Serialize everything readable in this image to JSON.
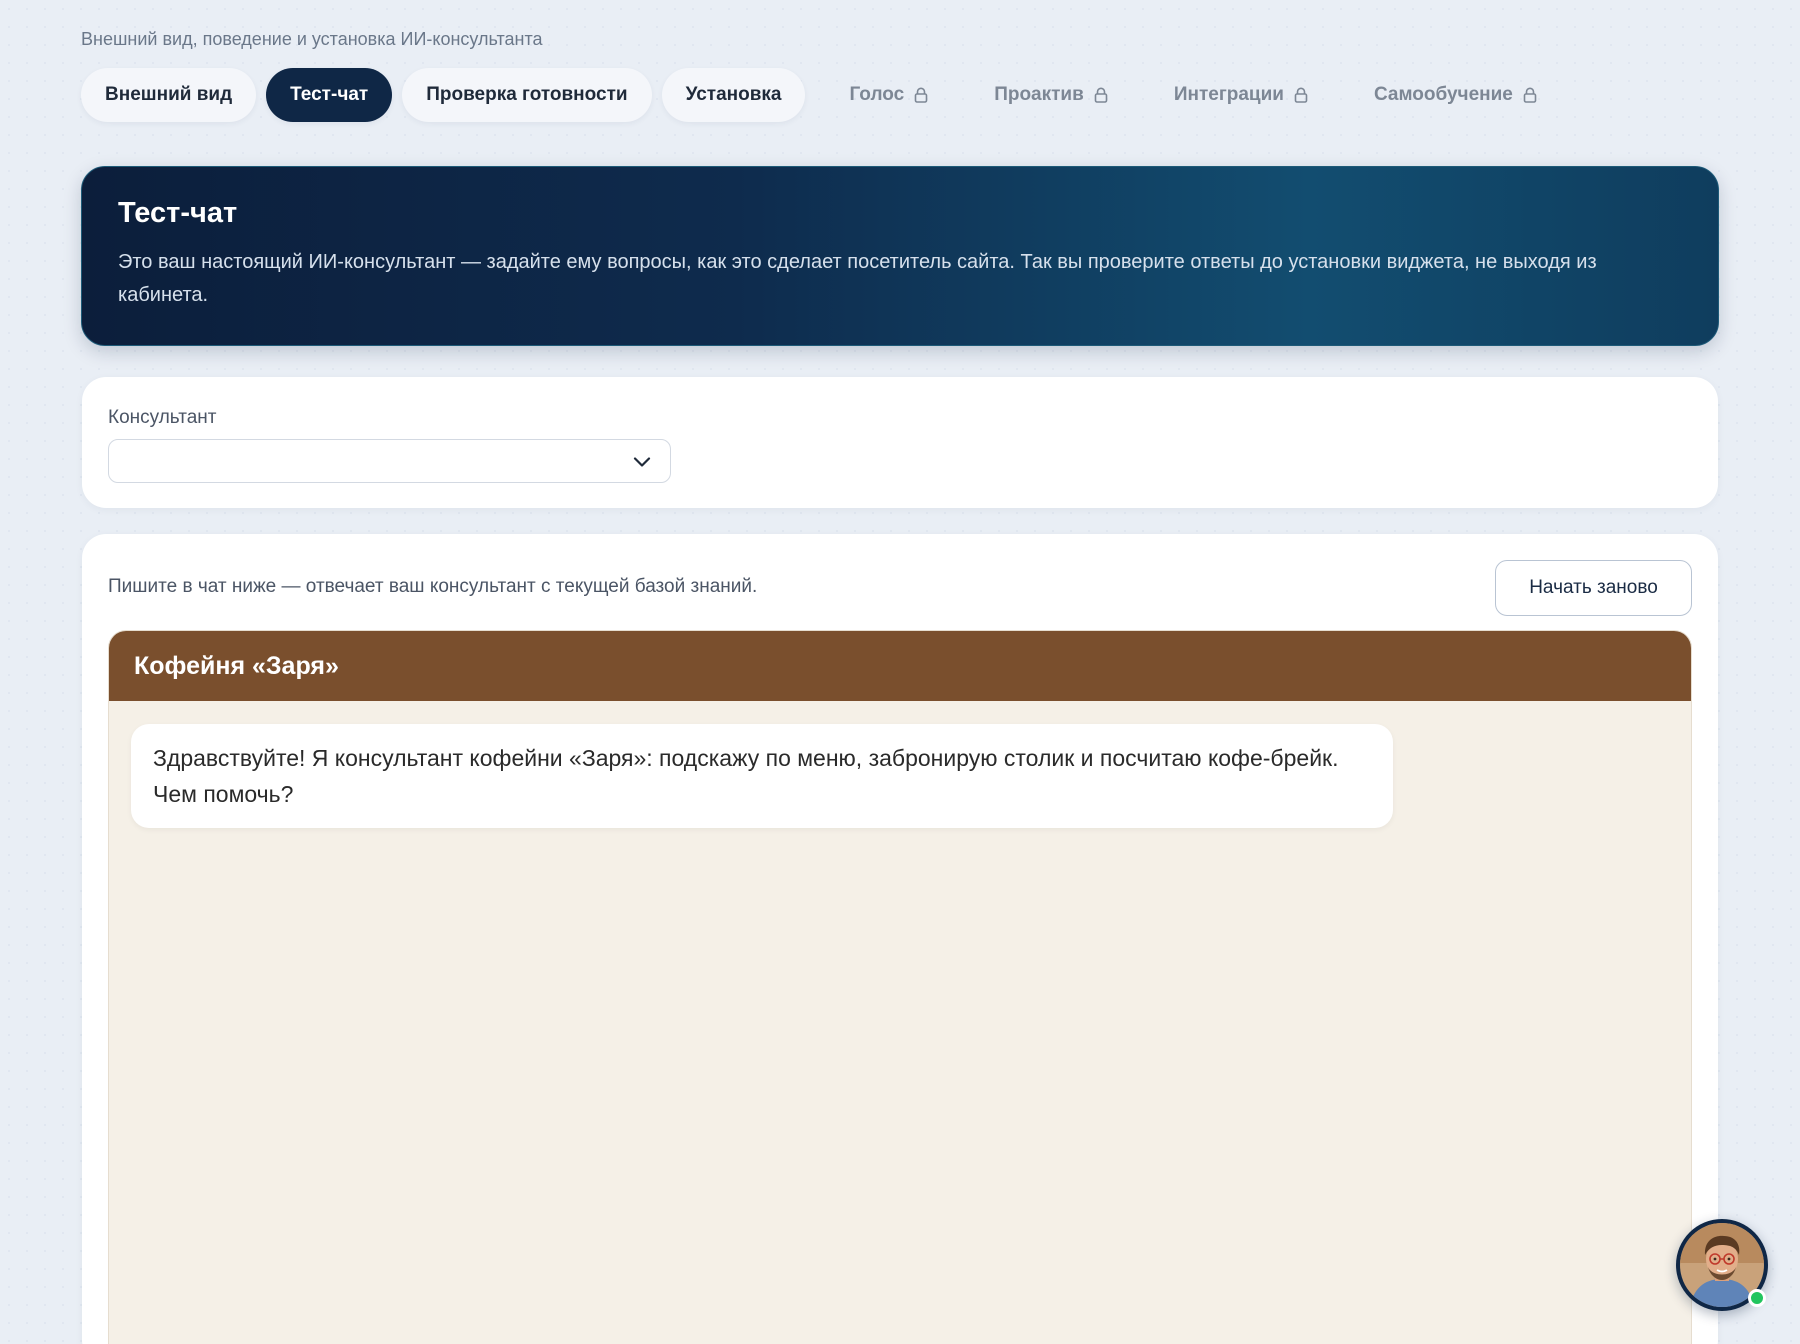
{
  "page": {
    "subtitle": "Внешний вид, поведение и установка ИИ-консультанта"
  },
  "tabs": [
    {
      "label": "Внешний вид",
      "active": false,
      "locked": false
    },
    {
      "label": "Тест-чат",
      "active": true,
      "locked": false
    },
    {
      "label": "Проверка готовности",
      "active": false,
      "locked": false
    },
    {
      "label": "Установка",
      "active": false,
      "locked": false
    },
    {
      "label": "Голос",
      "active": false,
      "locked": true
    },
    {
      "label": "Проактив",
      "active": false,
      "locked": true
    },
    {
      "label": "Интеграции",
      "active": false,
      "locked": true
    },
    {
      "label": "Самообучение",
      "active": false,
      "locked": true
    }
  ],
  "hero": {
    "title": "Тест-чат",
    "text": "Это ваш настоящий ИИ-консультант — задайте ему вопросы, как это сделает посетитель сайта. Так вы проверите ответы до установки виджета, не выходя из кабинета."
  },
  "consultant": {
    "label": "Консультант",
    "selected": ""
  },
  "chat": {
    "hint": "Пишите в чат ниже — отвечает ваш консультант с текущей базой знаний.",
    "restart_label": "Начать заново",
    "widget_title": "Кофейня «Заря»",
    "greeting": "Здравствуйте! Я консультант кофейни «Заря»: подскажу по меню, забронирую столик и посчитаю кофе-брейк. Чем помочь?"
  },
  "colors": {
    "accent": "#0f2746",
    "widget_header": "#7a4f2d",
    "widget_bg": "#f5f0e7",
    "online": "#22c55e"
  },
  "icons": {
    "lock": "lock-icon",
    "chevron": "chevron-down-icon",
    "avatar": "consultant-avatar"
  }
}
